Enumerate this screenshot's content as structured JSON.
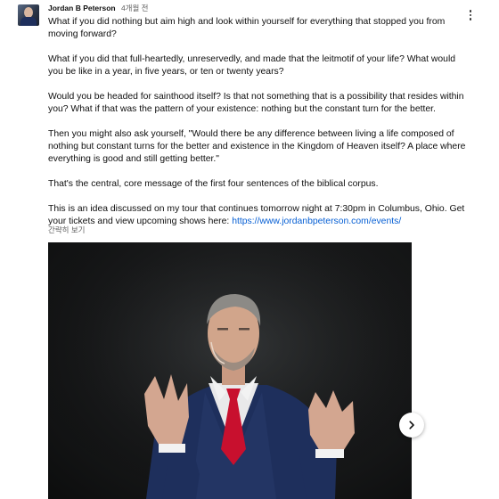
{
  "post": {
    "author": "Jordan B Peterson",
    "time": "4개월 전",
    "paragraphs": [
      "What if you did nothing but aim high and look within yourself for everything that stopped you from moving forward?",
      "What if you did that full-heartedly, unreservedly, and made that the leitmotif of your life? What would you be like in a year, in five years, or ten or twenty years?",
      "Would you be headed for sainthood itself? Is that not something that is a possibility that resides within you? What if that was the pattern of your existence: nothing but the constant turn for the better.",
      "Then you might also ask yourself, \"Would there be any difference between living a life composed of nothing but constant turns for the better and existence in the Kingdom of Heaven itself? A place where everything is good and still getting better.\"",
      "That's the central, core message of the first four sentences of the biblical corpus."
    ],
    "tour_text": "This is an idea discussed on my tour that continues tomorrow night at 7:30pm in Columbus, Ohio. Get your tickets and view upcoming shows here: ",
    "tour_link": "https://www.jordanbpeterson.com/events/",
    "show_less": "간략히 보기"
  },
  "icons": {
    "menu": "more-vert-icon",
    "next": "chevron-right-icon"
  },
  "colors": {
    "link": "#065fd4",
    "secondary_text": "#606060",
    "tie": "#c8102e",
    "suit": "#1e2f5c"
  }
}
